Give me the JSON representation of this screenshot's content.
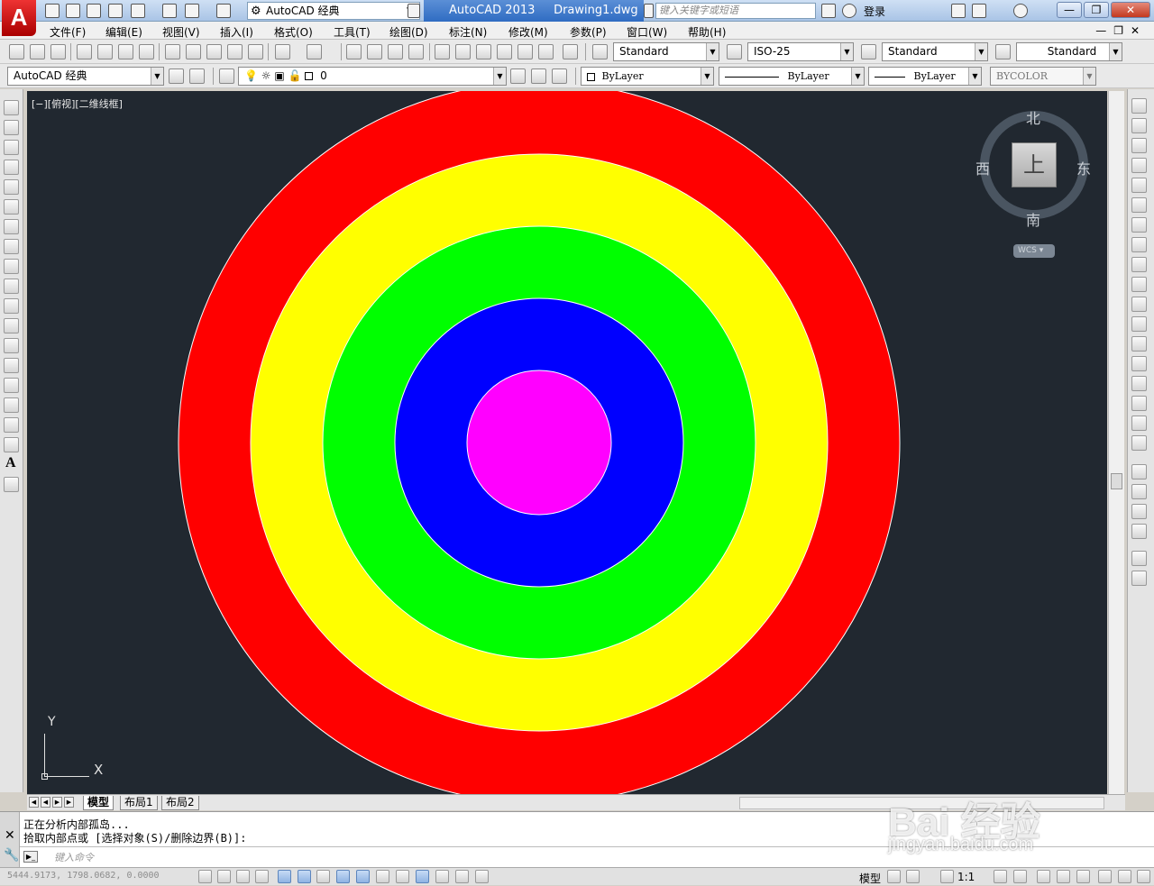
{
  "app": {
    "logo_letter": "A",
    "workspace": "AutoCAD 经典",
    "title_app": "AutoCAD 2013",
    "title_file": "Drawing1.dwg",
    "search_placeholder": "键入关键字或短语",
    "login": "登录",
    "win_minimize": "—",
    "win_restore": "❐",
    "win_close": "✕"
  },
  "menu": {
    "items": [
      "文件(F)",
      "编辑(E)",
      "视图(V)",
      "插入(I)",
      "格式(O)",
      "工具(T)",
      "绘图(D)",
      "标注(N)",
      "修改(M)",
      "参数(P)",
      "窗口(W)",
      "帮助(H)"
    ],
    "mdi": "—❐✕"
  },
  "styles": {
    "text_style": "Standard",
    "dim_style": "ISO-25",
    "table_style": "Standard",
    "multileader_style": "Standard"
  },
  "layers": {
    "workspace": "AutoCAD 经典",
    "current_layer": "0",
    "color": "ByLayer",
    "linetype": "ByLayer",
    "lineweight": "ByLayer",
    "plot_style": "BYCOLOR"
  },
  "viewport": {
    "label": "[−][俯视][二维线框]",
    "compass_n": "北",
    "compass_s": "南",
    "compass_e": "东",
    "compass_w": "西",
    "cube_face": "上",
    "wcs": "WCS ▾",
    "ucs_x": "X",
    "ucs_y": "Y",
    "ring_colors": [
      "#ff0000",
      "#ffff00",
      "#00ff00",
      "#0000ff",
      "#ff00ff"
    ],
    "background": "#212830"
  },
  "layout_tabs": [
    "模型",
    "布局1",
    "布局2"
  ],
  "command": {
    "line1": "正在分析内部孤岛...",
    "line2": "拾取内部点或 [选择对象(S)/删除边界(B)]:",
    "input_placeholder": "键入命令"
  },
  "status": {
    "coords": "5444.9173, 1798.0682, 0.0000",
    "model": "模型",
    "scale": "1:1"
  },
  "watermark": {
    "brand": "Bai 经验",
    "url": "jingyan.baidu.com"
  }
}
